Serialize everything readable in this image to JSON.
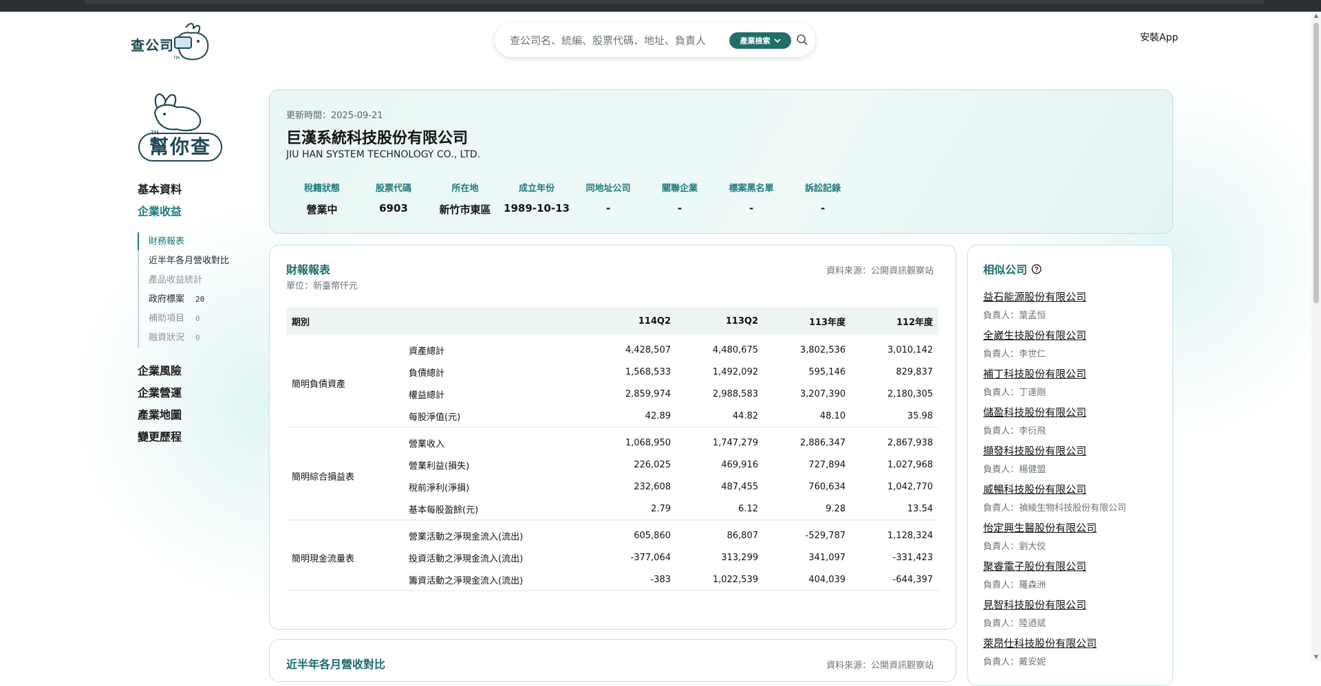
{
  "header": {
    "logo_text": "查公司",
    "search_placeholder": "查公司名、統編、股票代碼、地址、負責人",
    "industry_search_label": "產業檢索",
    "install_app": "安裝App"
  },
  "sidebar": {
    "brand": "幫你查",
    "nav": [
      {
        "label": "基本資料"
      },
      {
        "label": "企業收益"
      }
    ],
    "sub_items": [
      {
        "label": "財務報表",
        "count": ""
      },
      {
        "label": "近半年各月營收對比",
        "count": ""
      },
      {
        "label": "產品收益統計",
        "count": ""
      },
      {
        "label": "政府標案",
        "count": "20"
      },
      {
        "label": "補助項目",
        "count": "0"
      },
      {
        "label": "融資狀況",
        "count": "0"
      }
    ],
    "nav_lower": [
      {
        "label": "企業風險"
      },
      {
        "label": "企業營運"
      },
      {
        "label": "產業地圖"
      },
      {
        "label": "變更歷程"
      }
    ]
  },
  "company": {
    "update_time": "更新時間：2025-09-21",
    "name": "巨漢系統科技股份有限公司",
    "name_en": "JIU HAN SYSTEM TECHNOLOGY CO., LTD.",
    "stats": [
      {
        "label": "稅籍狀態",
        "value": "營業中"
      },
      {
        "label": "股票代碼",
        "value": "6903"
      },
      {
        "label": "所在地",
        "value": "新竹市東區"
      },
      {
        "label": "成立年份",
        "value": "1989-10-13"
      },
      {
        "label": "同地址公司",
        "value": "-"
      },
      {
        "label": "關聯企業",
        "value": "-"
      },
      {
        "label": "標案黑名單",
        "value": "-"
      },
      {
        "label": "訴訟記錄",
        "value": "-"
      }
    ]
  },
  "financial": {
    "title": "財報報表",
    "unit": "單位：新臺幣仟元",
    "source": "資料來源：公開資訊觀察站",
    "columns": [
      "期別",
      "114Q2",
      "113Q2",
      "113年度",
      "112年度"
    ],
    "groups": [
      {
        "name": "簡明負債資產",
        "rows": [
          {
            "item": "資產總計",
            "values": [
              "4,428,507",
              "4,480,675",
              "3,802,536",
              "3,010,142"
            ]
          },
          {
            "item": "負債總計",
            "values": [
              "1,568,533",
              "1,492,092",
              "595,146",
              "829,837"
            ]
          },
          {
            "item": "權益總計",
            "values": [
              "2,859,974",
              "2,988,583",
              "3,207,390",
              "2,180,305"
            ]
          },
          {
            "item": "每股淨值(元)",
            "values": [
              "42.89",
              "44.82",
              "48.10",
              "35.98"
            ]
          }
        ]
      },
      {
        "name": "簡明綜合損益表",
        "rows": [
          {
            "item": "營業收入",
            "values": [
              "1,068,950",
              "1,747,279",
              "2,886,347",
              "2,867,938"
            ]
          },
          {
            "item": "營業利益(損失)",
            "values": [
              "226,025",
              "469,916",
              "727,894",
              "1,027,968"
            ]
          },
          {
            "item": "稅前淨利(淨損)",
            "values": [
              "232,608",
              "487,455",
              "760,634",
              "1,042,770"
            ]
          },
          {
            "item": "基本每股盈餘(元)",
            "values": [
              "2.79",
              "6.12",
              "9.28",
              "13.54"
            ]
          }
        ]
      },
      {
        "name": "簡明現金流量表",
        "rows": [
          {
            "item": "營業活動之淨現金流入(流出)",
            "values": [
              "605,860",
              "86,807",
              "-529,787",
              "1,128,324"
            ]
          },
          {
            "item": "投資活動之淨現金流入(流出)",
            "values": [
              "-377,064",
              "313,299",
              "341,097",
              "-331,423"
            ]
          },
          {
            "item": "籌資活動之淨現金流入(流出)",
            "values": [
              "-383",
              "1,022,539",
              "404,039",
              "-644,397"
            ]
          }
        ]
      }
    ]
  },
  "next_section": {
    "title": "近半年各月營收對比",
    "source": "資料來源：公開資訊觀察站"
  },
  "similar": {
    "title": "相似公司",
    "items": [
      {
        "name": "益石能源股份有限公司",
        "person": "負責人：葉孟恒"
      },
      {
        "name": "全崴生技股份有限公司",
        "person": "負責人：李世仁"
      },
      {
        "name": "補丁科技股份有限公司",
        "person": "負責人：丁達剛"
      },
      {
        "name": "儲盈科技股份有限公司",
        "person": "負責人：李衍飛"
      },
      {
        "name": "擷發科技股份有限公司",
        "person": "負責人：楊健盟"
      },
      {
        "name": "威暢科技股份有限公司",
        "person": "負責人：禎綾生物科技股份有限公司"
      },
      {
        "name": "怡定興生醫股份有限公司",
        "person": "負責人：劉大佼"
      },
      {
        "name": "聚睿電子股份有限公司",
        "person": "負責人：羅森洲"
      },
      {
        "name": "見智科技股份有限公司",
        "person": "負責人：陸迺斌"
      },
      {
        "name": "萊昂仕科技股份有限公司",
        "person": "負責人：戴安妮"
      }
    ]
  },
  "colors": {
    "accent": "#1f7a7a",
    "brand_dark": "#1e4752",
    "card_bg": "#e9f7f6"
  }
}
